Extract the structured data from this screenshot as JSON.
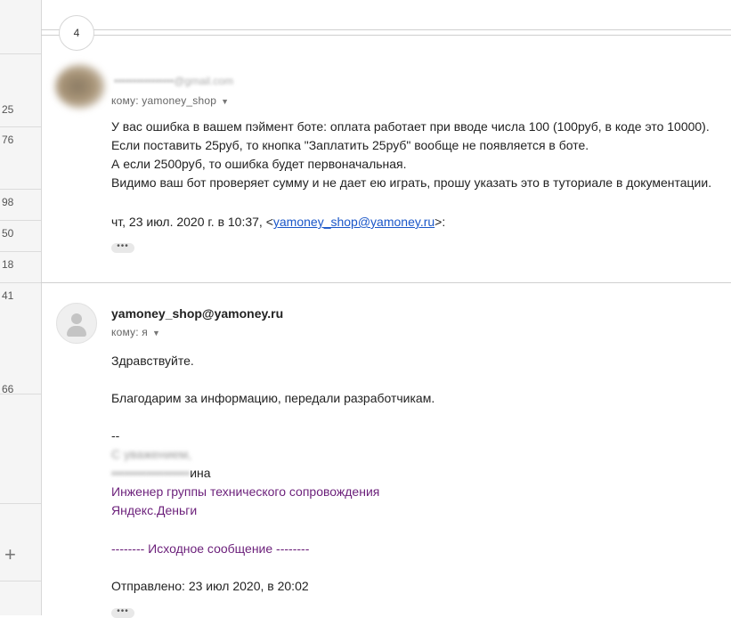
{
  "left_rail": {
    "numbers": [
      "25",
      "76",
      "98",
      "50",
      "18",
      "41",
      "66"
    ],
    "add_icon": "plus-icon"
  },
  "thread": {
    "collapsed_count": "4"
  },
  "message1": {
    "sender_email_blurred": "••••••••••••••••@gmail.com",
    "to_line": "кому: yamoney_shop",
    "body_lines": [
      "У вас ошибка в вашем пэймент боте: оплата работает при вводе числа 100 (100руб, в коде это 10000).",
      "Если поставить 25руб, то кнопка \"Заплатить 25руб\" вообще не появляется в боте.",
      "А если 2500руб, то ошибка будет первоначальная.",
      "Видимо ваш бот проверяет сумму и не дает ею играть, прошу указать это в туториале в документации."
    ],
    "quote_prefix": "чт, 23 июл. 2020 г. в 10:37, <",
    "quote_email": "yamoney_shop@yamoney.ru",
    "quote_suffix": ">:",
    "more_label": "•••"
  },
  "message2": {
    "sender": "yamoney_shop@yamoney.ru",
    "to_line": "кому: я",
    "greeting": "Здравствуйте.",
    "thanks": "Благодарим за информацию, передали разработчикам.",
    "sig_dashes": "--",
    "sig_regards_blurred": "С уважением,",
    "sig_name_blurred": "••••••••••••••••••",
    "sig_name_suffix": "ина",
    "sig_role": "Инженер группы технического сопровождения",
    "sig_company": "Яндекс.Деньги",
    "original_header": "-------- Исходное сообщение --------",
    "sent_line": "Отправлено: 23 июл 2020, в 20:02",
    "more_label": "•••"
  },
  "colors": {
    "link": "#1a56c8",
    "signature": "#6b1f7a"
  }
}
